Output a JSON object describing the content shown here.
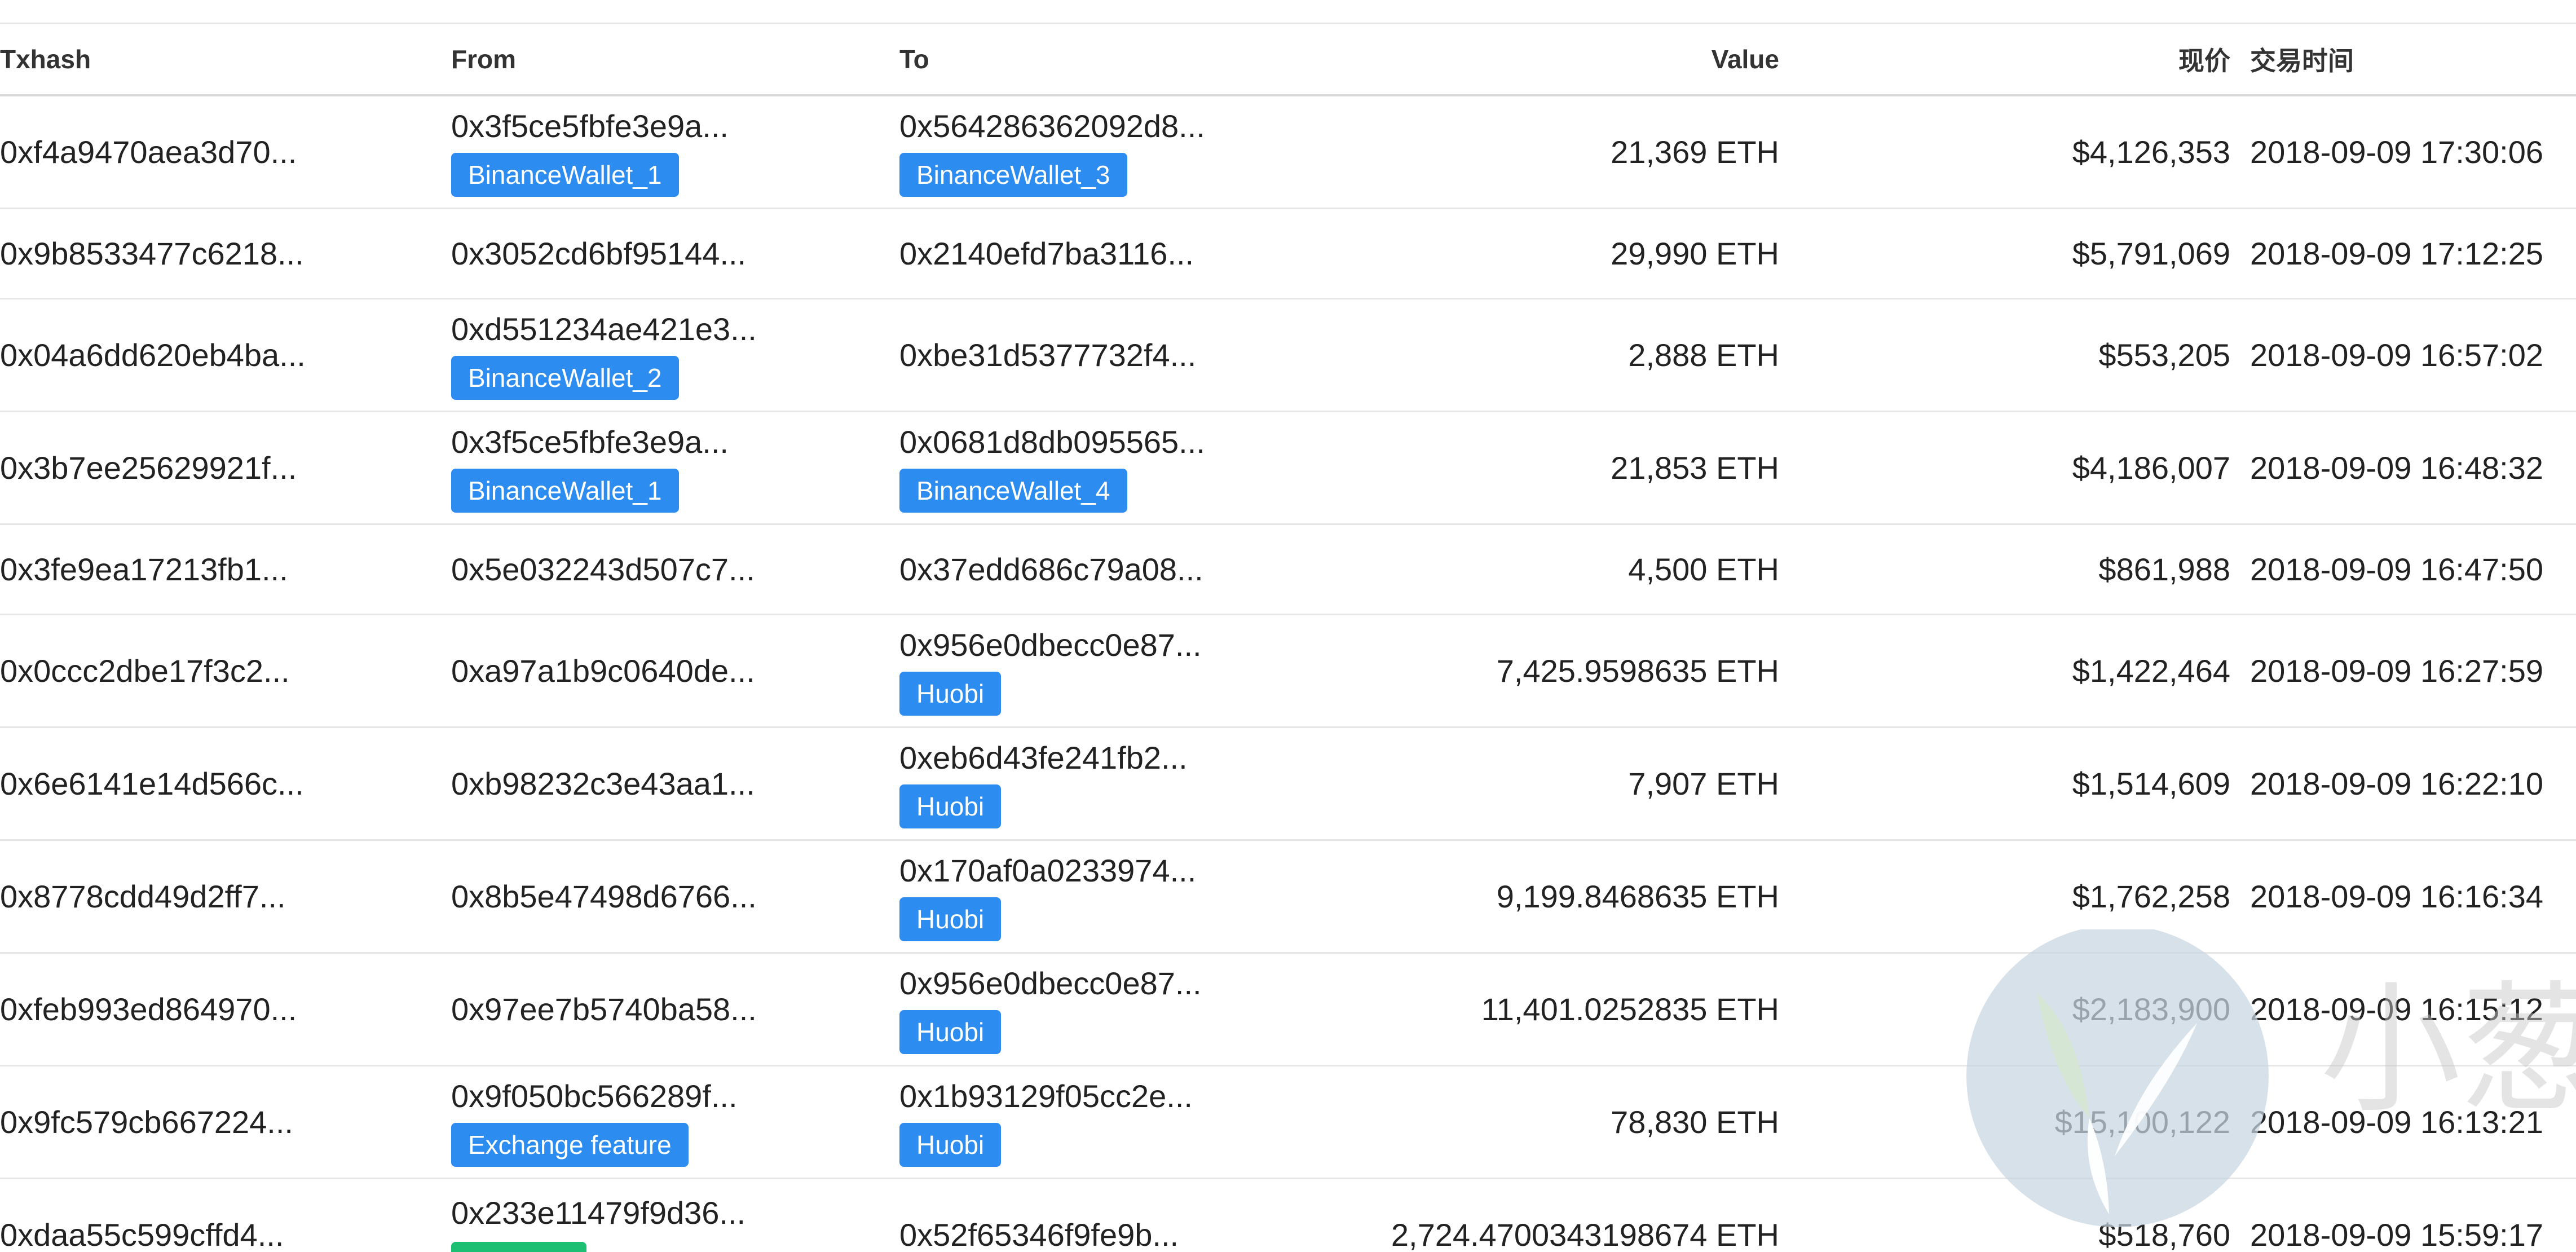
{
  "table": {
    "headers": [
      "Txhash",
      "From",
      "To",
      "Value",
      "现价",
      "交易时间"
    ],
    "rows": [
      {
        "hash": "0xf4a9470aea3d70...",
        "from": "0x3f5ce5fbfe3e9a...",
        "from_tag": "BinanceWallet_1",
        "to": "0x564286362092d8...",
        "to_tag": "BinanceWallet_3",
        "value": "21,369 ETH",
        "price": "$4,126,353",
        "time": "2018-09-09 17:30:06"
      },
      {
        "hash": "0x9b8533477c6218...",
        "from": "0x3052cd6bf95144...",
        "from_tag": "",
        "to": "0x2140efd7ba3116...",
        "to_tag": "",
        "value": "29,990 ETH",
        "price": "$5,791,069",
        "time": "2018-09-09 17:12:25"
      },
      {
        "hash": "0x04a6dd620eb4ba...",
        "from": "0xd551234ae421e3...",
        "from_tag": "BinanceWallet_2",
        "to": "0xbe31d5377732f4...",
        "to_tag": "",
        "value": "2,888 ETH",
        "price": "$553,205",
        "time": "2018-09-09 16:57:02"
      },
      {
        "hash": "0x3b7ee25629921f...",
        "from": "0x3f5ce5fbfe3e9a...",
        "from_tag": "BinanceWallet_1",
        "to": "0x0681d8db095565...",
        "to_tag": "BinanceWallet_4",
        "value": "21,853 ETH",
        "price": "$4,186,007",
        "time": "2018-09-09 16:48:32"
      },
      {
        "hash": "0x3fe9ea17213fb1...",
        "from": "0x5e032243d507c7...",
        "from_tag": "",
        "to": "0x37edd686c79a08...",
        "to_tag": "",
        "value": "4,500 ETH",
        "price": "$861,988",
        "time": "2018-09-09 16:47:50"
      },
      {
        "hash": "0x0ccc2dbe17f3c2...",
        "from": "0xa97a1b9c0640de...",
        "from_tag": "",
        "to": "0x956e0dbecc0e87...",
        "to_tag": "Huobi",
        "value": "7,425.9598635 ETH",
        "price": "$1,422,464",
        "time": "2018-09-09 16:27:59"
      },
      {
        "hash": "0x6e6141e14d566c...",
        "from": "0xb98232c3e43aa1...",
        "from_tag": "",
        "to": "0xeb6d43fe241fb2...",
        "to_tag": "Huobi",
        "value": "7,907 ETH",
        "price": "$1,514,609",
        "time": "2018-09-09 16:22:10"
      },
      {
        "hash": "0x8778cdd49d2ff7...",
        "from": "0x8b5e47498d6766...",
        "from_tag": "",
        "to": "0x170af0a0233974...",
        "to_tag": "Huobi",
        "value": "9,199.8468635 ETH",
        "price": "$1,762,258",
        "time": "2018-09-09 16:16:34"
      },
      {
        "hash": "0xfeb993ed864970...",
        "from": "0x97ee7b5740ba58...",
        "from_tag": "",
        "to": "0x956e0dbecc0e87...",
        "to_tag": "Huobi",
        "value": "11,401.0252835 ETH",
        "price": "$2,183,900",
        "time": "2018-09-09 16:15:12"
      },
      {
        "hash": "0x9fc579cb667224...",
        "from": "0x9f050bc566289f...",
        "from_tag": "Exchange feature",
        "to": "0x1b93129f05cc2e...",
        "to_tag": "Huobi",
        "value": "78,830 ETH",
        "price": "$15,100,122",
        "time": "2018-09-09 16:13:21"
      },
      {
        "hash": "0xdaa55c599cffd4...",
        "from": "0x233e11479f9d36...",
        "from_tag": "",
        "to": "0x52f65346f9fe9b...",
        "to_tag": "",
        "value": "2,724.4700343198674 ETH",
        "price": "$518,760",
        "time": "2018-09-09 15:59:17"
      }
    ]
  },
  "colors": {
    "badge_blue": "#2d8cf0",
    "badge_green": "#1dbf73",
    "row_divider": "#e6e6e6",
    "watermark_blue": "#c7d5e2",
    "watermark_green": "#d6e7d1"
  },
  "watermark": {
    "text": "小葱"
  }
}
